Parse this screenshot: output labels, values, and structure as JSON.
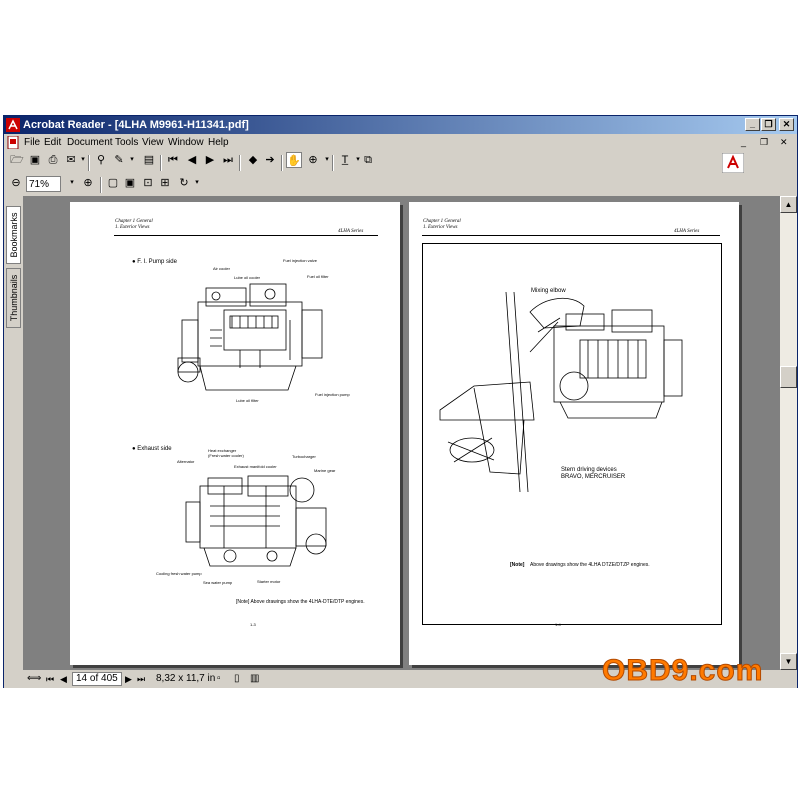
{
  "window": {
    "title": "Acrobat Reader - [4LHA   M9961-H11341.pdf]",
    "controls": [
      "_",
      "❐",
      "✕"
    ]
  },
  "menu": [
    "File",
    "Edit",
    "Document",
    "Tools",
    "View",
    "Window",
    "Help"
  ],
  "toolbar": {
    "zoom_value": "71%"
  },
  "sidebar": {
    "tabs": [
      "Bookmarks",
      "Thumbnails"
    ]
  },
  "page_left": {
    "header_chapter": "Chapter 1 General",
    "header_section": "1. Exterior Views",
    "series": "4LHA Series",
    "fig1_title": "● F. I. Pump side",
    "fig1_labels": [
      "Air cooler",
      "Lube oil cooler",
      "Fuel injection valve",
      "Fuel oil filter",
      "Fuel injection pump",
      "Lube oil filter"
    ],
    "fig2_title": "● Exhaust side",
    "fig2_labels": [
      "Heat exchanger",
      "(Fresh water cooler)",
      "Alternator",
      "Exhaust manifold cooler",
      "Turbocharger",
      "Marine gear",
      "Cooling fresh water pump",
      "Sea water pump",
      "Starter motor"
    ],
    "note": "[Note] Above drawings show the 4LHA-DTE/DTP engines.",
    "page_num": "1-3"
  },
  "page_right": {
    "header_chapter": "Chapter 1 General",
    "header_section": "1. Exterior Views",
    "series": "4LHA Series",
    "label_mixing": "Mixing elbow",
    "label_stern1": "Stern driving devices",
    "label_stern2": "BRAVO, MERCRUISER",
    "note_tag": "[Note]",
    "note_text": "Above drawings show the 4LHA DTZE/DTZP engines.",
    "page_num": "1-4"
  },
  "status": {
    "page": "14 of 405",
    "size": "8,32 x 11,7 in"
  },
  "watermark": "OBD9.com",
  "colors": {
    "titlebar": "#0a246a",
    "chrome": "#d4d0c8",
    "workspace": "#808080",
    "watermark": "#ff7a00"
  }
}
